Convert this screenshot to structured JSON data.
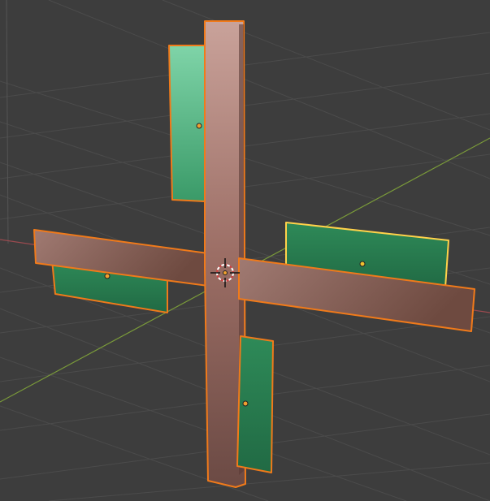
{
  "viewport": {
    "background_color": "#3d3d3d",
    "grid_color": "#4a4a4a",
    "x_axis_color": "#9a4a4f",
    "y_axis_color": "#7a9a3a",
    "selection_outline_color": "#f07a1a",
    "active_outline_color": "#ffd24a",
    "object_colors": {
      "frame_wood": "#a8756c",
      "panel_green": "#2f8a5a"
    },
    "icons": {
      "cursor": "3d-cursor-icon",
      "origin": "object-origin-icon"
    }
  }
}
